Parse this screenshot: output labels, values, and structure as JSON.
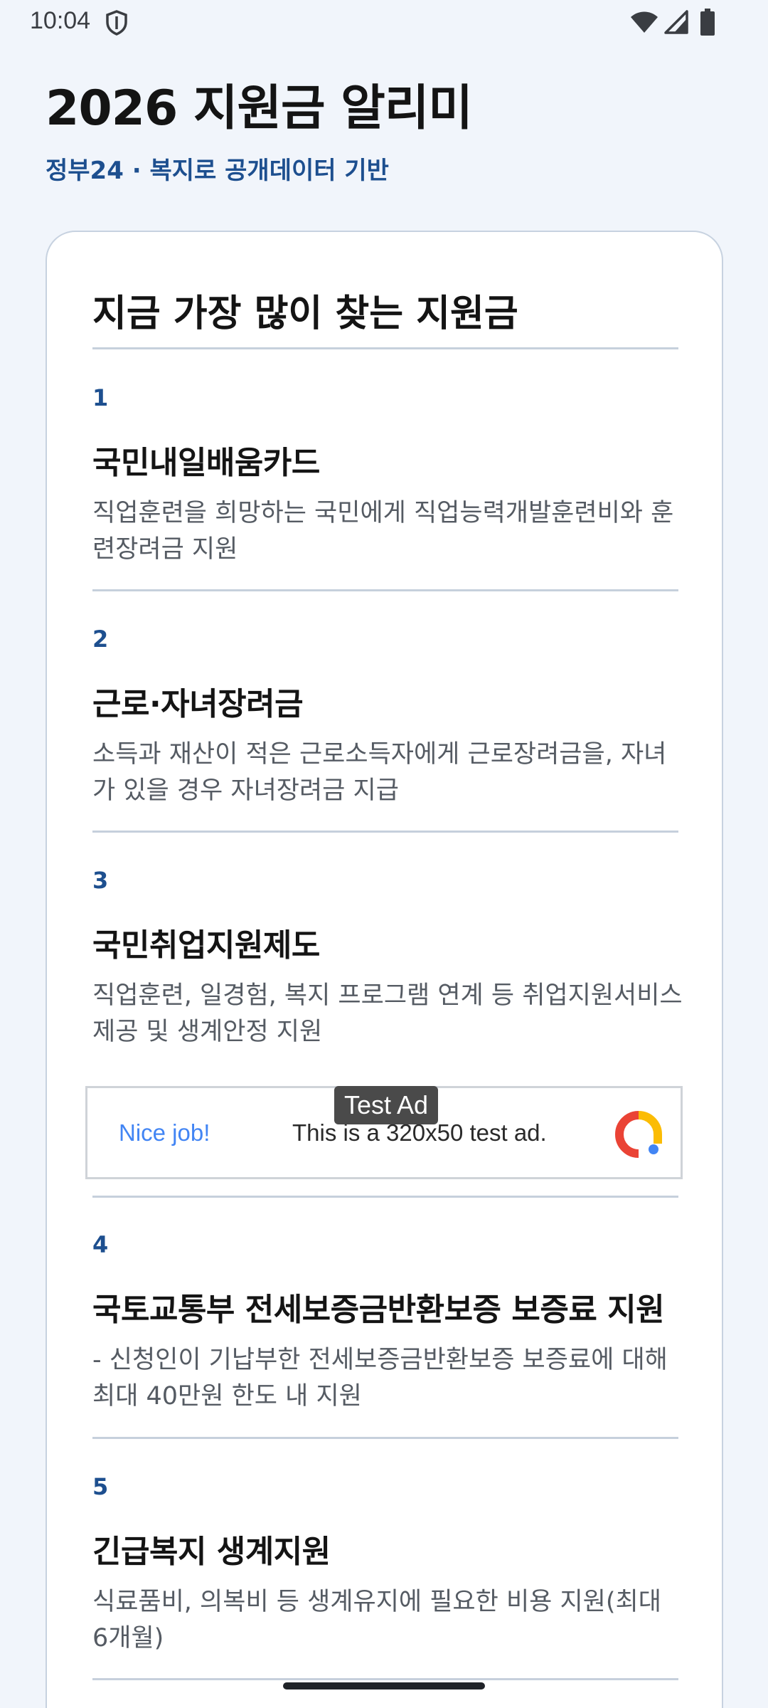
{
  "status_bar": {
    "time": "10:04",
    "icons": [
      "shield-icon",
      "wifi-icon",
      "signal-icon",
      "battery-icon"
    ]
  },
  "header": {
    "title": "2026 지원금 알리미",
    "subtitle": "정부24 · 복지로 공개데이터 기반"
  },
  "card": {
    "title": "지금 가장 많이 찾는 지원금",
    "items": [
      {
        "rank": "1",
        "name": "국민내일배움카드",
        "desc": "직업훈련을 희망하는 국민에게 직업능력개발훈련비와 훈련장려금 지원"
      },
      {
        "rank": "2",
        "name": "근로·자녀장려금",
        "desc": "소득과 재산이 적은 근로소득자에게 근로장려금을, 자녀가 있을 경우 자녀장려금 지급"
      },
      {
        "rank": "3",
        "name": "국민취업지원제도",
        "desc": "직업훈련, 일경험, 복지 프로그램 연계 등 취업지원서비스 제공 및 생계안정 지원"
      },
      {
        "rank": "4",
        "name": "국토교통부 전세보증금반환보증 보증료 지원",
        "desc": "- 신청인이 기납부한 전세보증금반환보증 보증료에 대해 최대 40만원 한도 내 지원"
      },
      {
        "rank": "5",
        "name": "긴급복지 생계지원",
        "desc": "식료품비, 의복비 등 생계유지에 필요한 비용 지원(최대 6개월)"
      }
    ]
  },
  "ad": {
    "label": "Test Ad",
    "nice": "Nice job!",
    "text": "This is a 320x50 test ad."
  },
  "colors": {
    "accent": "#1d4f8f",
    "background": "#f1f5fb",
    "ad_blue": "#4285f4"
  }
}
